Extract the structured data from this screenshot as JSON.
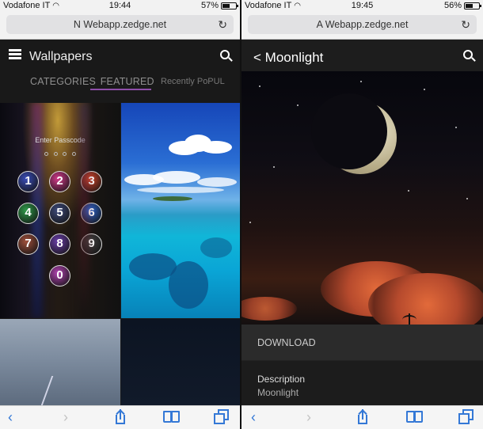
{
  "left_screen": {
    "status": {
      "carrier": "Vodafone IT",
      "time": "19:44",
      "battery": "57%"
    },
    "url": "N Webapp.zedge.net",
    "app_title": "Wallpapers",
    "tabs": {
      "categories": "CATEGORIES",
      "featured": "FEATURED",
      "extra": "Recently  PoPUL"
    },
    "lock_tile": {
      "prompt": "Enter Passcode",
      "keys": [
        "1",
        "2",
        "3",
        "4",
        "5",
        "6",
        "7",
        "8",
        "9",
        "0"
      ],
      "key_colors": [
        "#3a4db8",
        "#d23a8a",
        "#d9472a",
        "#2f9a4a",
        "#3e4a7a",
        "#2d6ad8",
        "#a0503c",
        "#6a3ea8",
        "#444444",
        "#b042b0"
      ]
    }
  },
  "right_screen": {
    "status": {
      "carrier": "Vodafone IT",
      "time": "19:45",
      "battery": "56%"
    },
    "url": "A Webapp.zedge.net",
    "title": "Moonlight",
    "download_label": "DOWNLOAD",
    "description_heading": "Description",
    "description_value": "Moonlight"
  },
  "colors": {
    "accent": "#8e4ea8",
    "safari_blue": "#3478d6"
  }
}
